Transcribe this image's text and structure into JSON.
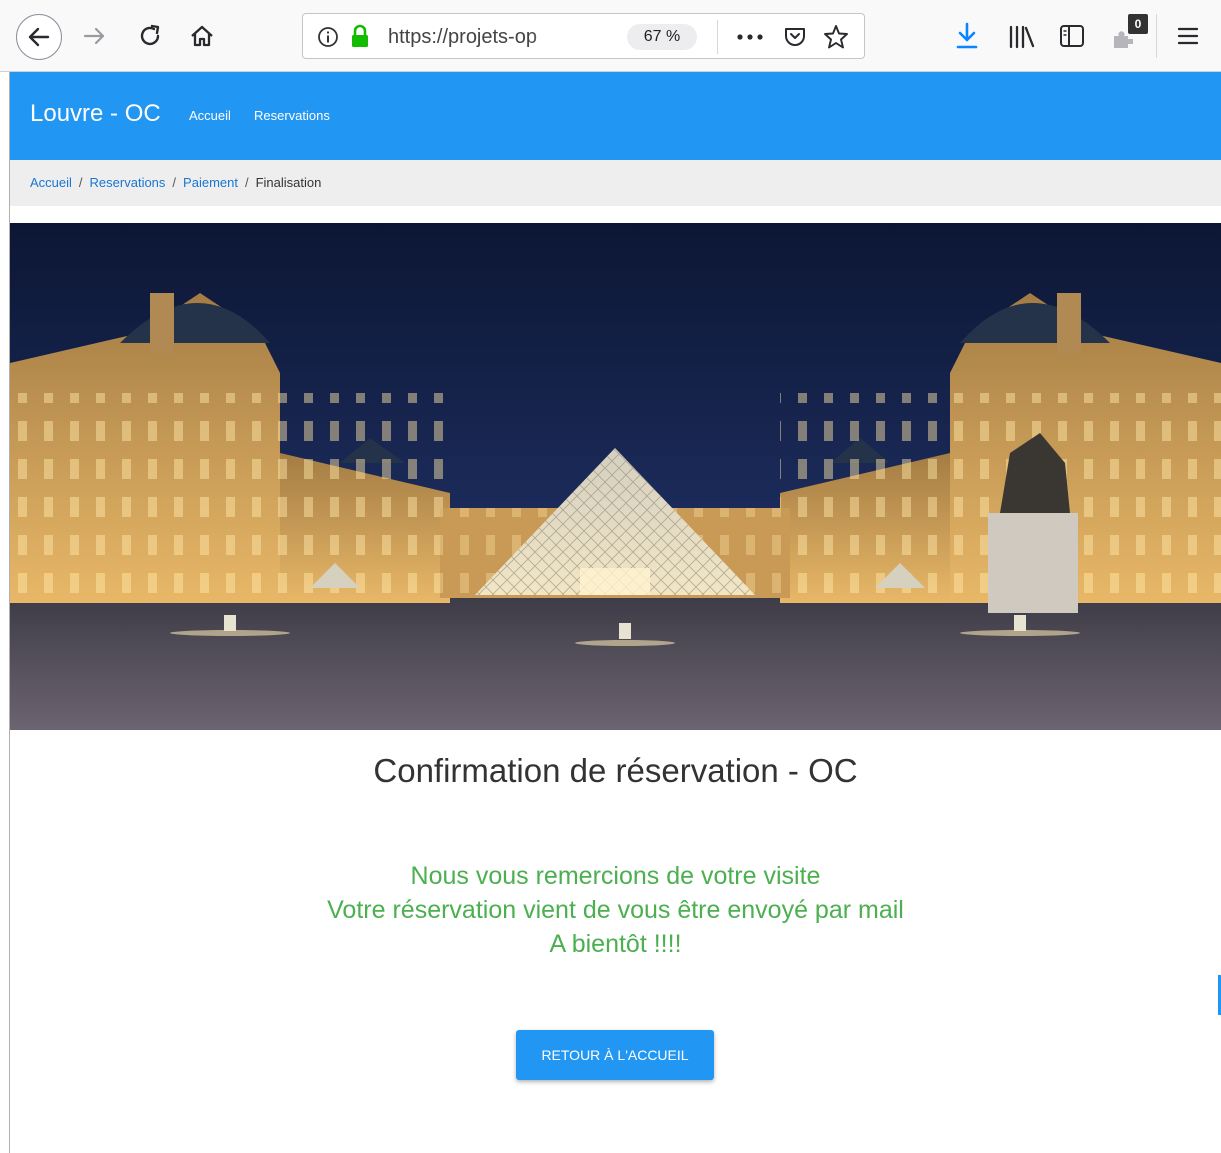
{
  "browser": {
    "url": "https://projets-op",
    "zoom": "67 %",
    "downloads_count": "0",
    "colors": {
      "download": "#0a84ff",
      "lock": "#12bc00"
    }
  },
  "site": {
    "brand": "Louvre - OC",
    "nav": [
      {
        "label": "Accueil"
      },
      {
        "label": "Reservations"
      }
    ],
    "colors": {
      "primary": "#2196f3",
      "success": "#4caf50"
    }
  },
  "breadcrumb": {
    "items": [
      {
        "label": "Accueil"
      },
      {
        "label": "Reservations"
      },
      {
        "label": "Paiement"
      },
      {
        "label": "Finalisation"
      }
    ],
    "separator": "/"
  },
  "hero": {
    "icon": "louvre-pyramid-night-photo"
  },
  "main": {
    "title": "Confirmation de réservation - OC",
    "messages": [
      "Nous vous remercions de votre visite",
      "Votre réservation vient de vous être envoyé par mail",
      "A bientôt !!!!"
    ],
    "cta_label": "RETOUR À L'ACCUEIL"
  }
}
